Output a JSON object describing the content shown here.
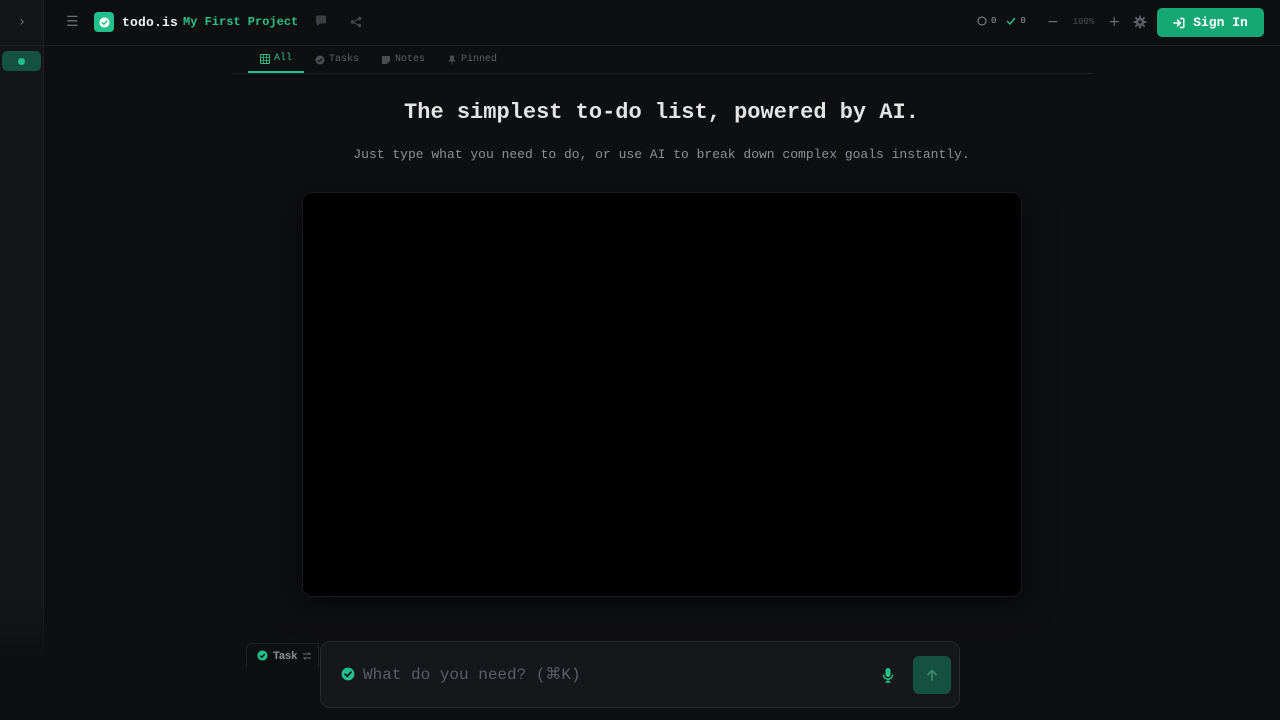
{
  "colors": {
    "accent": "#22c08a",
    "accent_dark": "#14523f",
    "button": "#16a874",
    "background": "#0e0f11"
  },
  "header": {
    "brand": "todo.is",
    "project_name": "My First Project",
    "pending_count": "0",
    "done_count": "0",
    "zoom_level": "100%",
    "sign_in_label": "Sign In"
  },
  "tabs": [
    {
      "label": "All",
      "icon": "grid-icon",
      "active": true
    },
    {
      "label": "Tasks",
      "icon": "check-circle-icon",
      "active": false
    },
    {
      "label": "Notes",
      "icon": "note-icon",
      "active": false
    },
    {
      "label": "Pinned",
      "icon": "pin-icon",
      "active": false
    }
  ],
  "hero": {
    "title": "The simplest to-do list, powered by AI.",
    "subtitle": "Just type what you need to do, or use AI to break down complex goals instantly."
  },
  "composer": {
    "mode_label": "Task",
    "placeholder": "What do you need? (⌘K)",
    "value": ""
  }
}
